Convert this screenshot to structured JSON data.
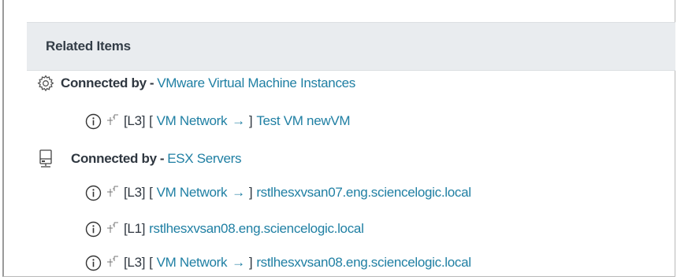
{
  "header": {
    "title": "Related Items"
  },
  "groups": [
    {
      "prefix": "Connected by",
      "separator": "-",
      "name": "VMware Virtual Machine Instances",
      "icon": "gear-icon",
      "items": [
        {
          "level": "[L3]",
          "open": "[",
          "network": "VM Network",
          "arrow": "→",
          "close": "]",
          "name": "Test VM newVM"
        }
      ]
    },
    {
      "prefix": "Connected by",
      "separator": "-",
      "name": "ESX Servers",
      "icon": "server-icon",
      "items": [
        {
          "level": "[L3]",
          "open": "[",
          "network": "VM Network",
          "arrow": "→",
          "close": "]",
          "name": "rstlhesxvsan07.eng.sciencelogic.local"
        },
        {
          "level": "[L1]",
          "name": "rstlhesxvsan08.eng.sciencelogic.local"
        },
        {
          "level": "[L3]",
          "open": "[",
          "network": "VM Network",
          "arrow": "→",
          "close": "]",
          "name": "rstlhesxvsan08.eng.sciencelogic.local"
        }
      ]
    }
  ],
  "colors": {
    "link": "#1f7fa3",
    "text": "#2f3740",
    "header_bg": "#e9ecef"
  }
}
